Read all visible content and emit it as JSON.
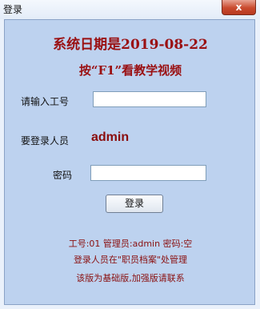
{
  "window": {
    "title": "登录",
    "close_glyph": "x"
  },
  "header": {
    "system_date": "系统日期是2019-08-22",
    "f1_tip": "按“F1”看教学视频"
  },
  "form": {
    "employee_id_label": "请输入工号",
    "employee_id_value": "",
    "login_user_label": "要登录人员",
    "login_user_value": "admin",
    "password_label": "密码",
    "password_value": "",
    "login_button": "登录"
  },
  "footer": {
    "line1": "工号:01 管理员:admin   密码:空",
    "line2": "登录人员在\"职员档案\"处管理",
    "line3": "该版为基础版,加强版请联系"
  }
}
